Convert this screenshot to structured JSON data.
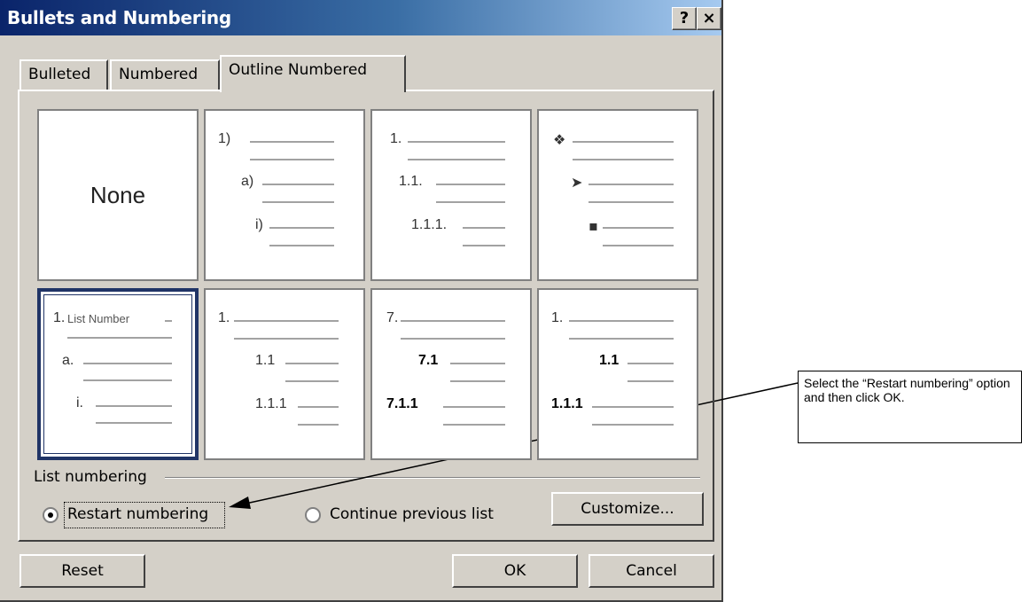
{
  "dialog": {
    "title": "Bullets and Numbering",
    "help_button": "?",
    "close_button": "×"
  },
  "tabs": [
    {
      "label": "Bulleted",
      "active": false
    },
    {
      "label": "Numbered",
      "active": false
    },
    {
      "label": "Outline Numbered",
      "active": true
    }
  ],
  "presets": [
    {
      "name": "None",
      "selected": false,
      "levels": []
    },
    {
      "selected": false,
      "levels": [
        "1)",
        "a)",
        "i)"
      ]
    },
    {
      "selected": false,
      "levels": [
        "1.",
        "1.1.",
        "1.1.1."
      ]
    },
    {
      "selected": false,
      "levels": [
        "❖",
        "➤",
        "▪"
      ]
    },
    {
      "selected": true,
      "levels": [
        "1.",
        "a.",
        "i."
      ],
      "first_text": "List Number"
    },
    {
      "selected": false,
      "levels": [
        "1.",
        "1.1",
        "1.1.1"
      ]
    },
    {
      "selected": false,
      "levels": [
        "7.",
        "7.1",
        "7.1.1"
      ]
    },
    {
      "selected": false,
      "levels": [
        "1.",
        "1.1",
        "1.1.1"
      ]
    }
  ],
  "list_numbering": {
    "group_label": "List numbering",
    "restart_label": "Restart numbering",
    "continue_label": "Continue previous list",
    "selected": "restart"
  },
  "buttons": {
    "customize": "Customize...",
    "reset": "Reset",
    "ok": "OK",
    "cancel": "Cancel"
  },
  "callout": {
    "text": "Select the “Restart numbering” option and then click OK."
  }
}
